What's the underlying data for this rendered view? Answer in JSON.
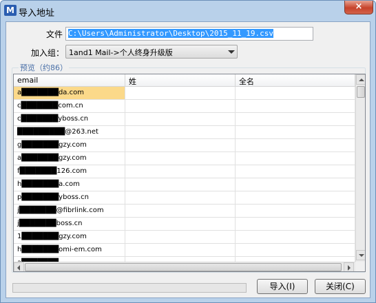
{
  "window": {
    "title": "导入地址",
    "icon": "app-logo-icon",
    "close_glyph": "×"
  },
  "form": {
    "file_label": "文件",
    "file_value": "C:\\Users\\Administrator\\Desktop\\2015_11_19.csv",
    "group_label": "加入组：",
    "group_value": "1and1 Mail->个人终身升级版"
  },
  "preview": {
    "legend": "预览（约86）",
    "columns": [
      "email",
      "姓",
      "全名"
    ],
    "rows": [
      {
        "email": "a███████da.com",
        "last": "",
        "full": ""
      },
      {
        "email": "c███████com.cn",
        "last": "",
        "full": ""
      },
      {
        "email": "c███████yboss.cn",
        "last": "",
        "full": ""
      },
      {
        "email": "█████████@263.net",
        "last": "",
        "full": ""
      },
      {
        "email": "g███████gzy.com",
        "last": "",
        "full": ""
      },
      {
        "email": "a███████gzy.com",
        "last": "",
        "full": ""
      },
      {
        "email": "f███████126.com",
        "last": "",
        "full": ""
      },
      {
        "email": "h███████a.com",
        "last": "",
        "full": ""
      },
      {
        "email": "p███████yboss.cn",
        "last": "",
        "full": ""
      },
      {
        "email": "j███████@fibrlink.com",
        "last": "",
        "full": ""
      },
      {
        "email": "j███████boss.cn",
        "last": "",
        "full": ""
      },
      {
        "email": "1███████gzy.com",
        "last": "",
        "full": ""
      },
      {
        "email": "h███████omi-em.com",
        "last": "",
        "full": ""
      },
      {
        "email": "a███████",
        "last": "",
        "full": ""
      }
    ]
  },
  "footer": {
    "progress": 0,
    "import_label": "导入(I)",
    "close_label": "关闭(C)"
  }
}
